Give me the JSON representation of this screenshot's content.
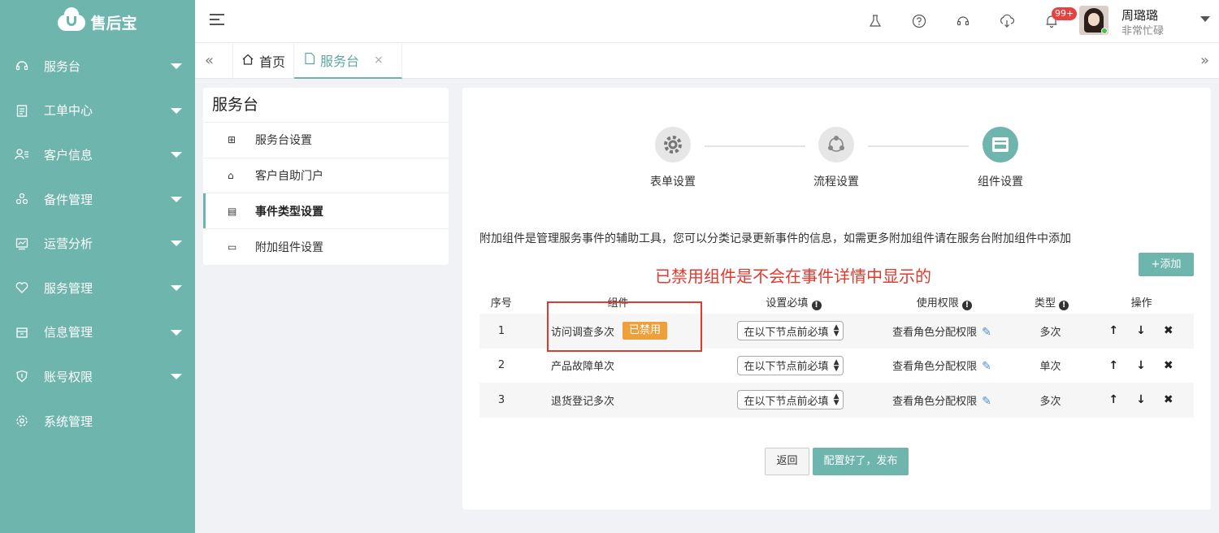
{
  "app": {
    "logo_text": "售后宝"
  },
  "sidebar": {
    "items": [
      {
        "label": "服务台",
        "icon": "headset-icon"
      },
      {
        "label": "工单中心",
        "icon": "clipboard-icon"
      },
      {
        "label": "客户信息",
        "icon": "users-icon"
      },
      {
        "label": "备件管理",
        "icon": "parts-icon"
      },
      {
        "label": "运营分析",
        "icon": "chart-icon"
      },
      {
        "label": "服务管理",
        "icon": "heart-icon"
      },
      {
        "label": "信息管理",
        "icon": "folder-icon"
      },
      {
        "label": "账号权限",
        "icon": "shield-icon"
      },
      {
        "label": "系统管理",
        "icon": "gear-icon"
      }
    ]
  },
  "topbar": {
    "badge": "99+",
    "user_name": "周璐璐",
    "user_status": "非常忙碌"
  },
  "tabs": {
    "home": "首页",
    "active": "服务台",
    "close": "×"
  },
  "submenu": {
    "title": "服务台",
    "items": [
      {
        "label": "服务台设置"
      },
      {
        "label": "客户自助门户"
      },
      {
        "label": "事件类型设置"
      },
      {
        "label": "附加组件设置"
      }
    ]
  },
  "steps": [
    {
      "label": "表单设置"
    },
    {
      "label": "流程设置"
    },
    {
      "label": "组件设置"
    }
  ],
  "description": "附加组件是管理服务事件的辅助工具，您可以分类记录更新事件的信息，如需更多附加组件请在服务台附加组件中添加",
  "notice": "已禁用组件是不会在事件详情中显示的",
  "add_button": "+添加",
  "table": {
    "headers": {
      "index": "序号",
      "component": "组件",
      "required": "设置必填",
      "permission": "使用权限",
      "type": "类型",
      "actions": "操作"
    },
    "rows": [
      {
        "index": "1",
        "component": "访问调查多次",
        "tag": "已禁用",
        "required": "在以下节点前必填",
        "permission": "查看角色分配权限",
        "type": "多次"
      },
      {
        "index": "2",
        "component": "产品故障单次",
        "tag": "",
        "required": "在以下节点前必填",
        "permission": "查看角色分配权限",
        "type": "单次"
      },
      {
        "index": "3",
        "component": "退货登记多次",
        "tag": "",
        "required": "在以下节点前必填",
        "permission": "查看角色分配权限",
        "type": "多次"
      }
    ]
  },
  "buttons": {
    "back": "返回",
    "publish": "配置好了，发布"
  },
  "colors": {
    "accent": "#6eb5ae",
    "warning": "#f0a03a",
    "danger": "#e03a2f"
  }
}
